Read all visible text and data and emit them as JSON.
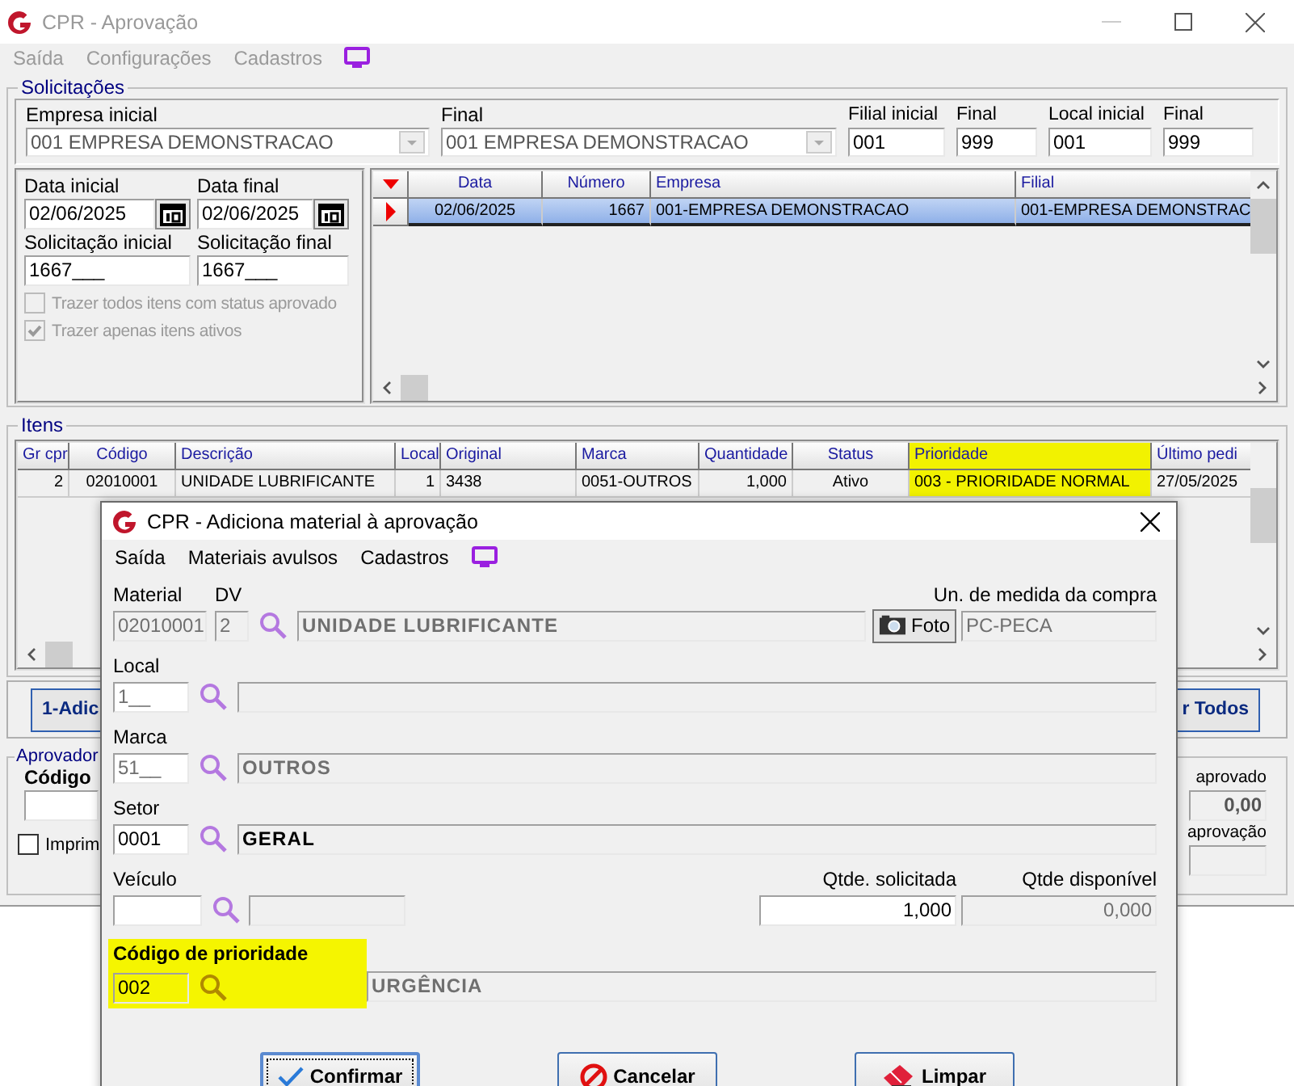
{
  "window": {
    "title": "CPR - Aprovação"
  },
  "menu": [
    {
      "label": "Saída",
      "disabled": true
    },
    {
      "label": "Configurações",
      "disabled": true
    },
    {
      "label": "Cadastros",
      "disabled": true
    }
  ],
  "solicitacoes": {
    "legend": "Solicitações",
    "filters": [
      {
        "label": "Empresa inicial",
        "value": "001 EMPRESA DEMONSTRACAO",
        "kind": "combo"
      },
      {
        "label": "Final",
        "value": "001 EMPRESA DEMONSTRACAO",
        "kind": "combo"
      },
      {
        "label": "Filial inicial",
        "value": "001",
        "kind": "text"
      },
      {
        "label": "Final",
        "value": "999",
        "kind": "text"
      },
      {
        "label": "Local inicial",
        "value": "001",
        "kind": "text"
      },
      {
        "label": "Final",
        "value": "999",
        "kind": "text"
      }
    ],
    "range": [
      {
        "label": "Data inicial",
        "value": "02/06/2025",
        "kind": "date"
      },
      {
        "label": "Data final",
        "value": "02/06/2025",
        "kind": "date"
      },
      {
        "label": "Solicitação inicial",
        "value": "1667___",
        "kind": "text"
      },
      {
        "label": "Solicitação final",
        "value": "1667___",
        "kind": "text"
      }
    ],
    "options": [
      {
        "label": "Trazer todos itens com status aprovado",
        "checked": false,
        "disabled": true
      },
      {
        "label": "Trazer apenas itens ativos",
        "checked": true,
        "disabled": true
      }
    ],
    "table": {
      "columns": [
        "Data",
        "Número",
        "Empresa",
        "Filial"
      ],
      "rows": [
        {
          "cells": [
            "02/06/2025",
            "1667",
            "001-EMPRESA DEMONSTRACAO",
            "001-EMPRESA DEMONSTRAC"
          ],
          "selected": true
        }
      ]
    }
  },
  "itens": {
    "legend": "Itens",
    "table": {
      "columns": [
        {
          "label": "Gr cpr",
          "highlighted": false
        },
        {
          "label": "Código",
          "highlighted": false
        },
        {
          "label": "Descrição",
          "highlighted": false
        },
        {
          "label": "Local",
          "highlighted": false
        },
        {
          "label": "Original",
          "highlighted": false
        },
        {
          "label": "Marca",
          "highlighted": false
        },
        {
          "label": "Quantidade",
          "highlighted": false
        },
        {
          "label": "Status",
          "highlighted": false
        },
        {
          "label": "Prioridade",
          "highlighted": true
        },
        {
          "label": "Último pedi",
          "highlighted": false
        }
      ],
      "rows": [
        {
          "cells": [
            "2",
            "02010001",
            "UNIDADE LUBRIFICANTE",
            "1",
            "3438",
            "0051-OUTROS",
            "1,000",
            "Ativo",
            "003 - PRIORIDADE NORMAL",
            "27/05/2025"
          ],
          "selected": false
        }
      ]
    }
  },
  "actions": [
    "1-Adic",
    "r Todos"
  ],
  "aprovador": {
    "legend": "Aprovador",
    "code_label": "Código",
    "print_option": {
      "label": "Imprim",
      "checked": false
    },
    "approved_label": "aprovado",
    "approved_value": "0,00",
    "approval_label": "aprovação"
  },
  "dialog": {
    "title": "CPR - Adiciona material à aprovação",
    "menu": [
      {
        "label": "Saída",
        "disabled": false
      },
      {
        "label": "Materiais avulsos",
        "disabled": false
      },
      {
        "label": "Cadastros",
        "disabled": false
      }
    ],
    "material": {
      "label": "Material",
      "value": "02010001"
    },
    "dv": {
      "label": "DV",
      "value": "2"
    },
    "material_description": "UNIDADE LUBRIFICANTE",
    "photo_button": "Foto",
    "unit": {
      "label": "Un. de medida da compra",
      "value": "PC-PECA"
    },
    "lookups": [
      {
        "label": "Local",
        "code": "1__",
        "disabled": true
      },
      {
        "label": "Marca",
        "code": "51__",
        "description": "OUTROS",
        "disabled": true
      },
      {
        "label": "Setor",
        "code": "0001",
        "description": "GERAL",
        "disabled": false
      }
    ],
    "vehicle": {
      "label": "Veículo"
    },
    "quantity_requested": {
      "label": "Qtde. solicitada",
      "value": "1,000"
    },
    "quantity_available": {
      "label": "Qtde disponível",
      "value": "0,000"
    },
    "priority": {
      "label": "Código de prioridade",
      "code": "002",
      "description": "URGÊNCIA",
      "highlighted": true
    },
    "buttons": [
      {
        "label": "Confirmar",
        "kind": "confirm"
      },
      {
        "label": "Cancelar",
        "kind": "cancel"
      },
      {
        "label": "Limpar",
        "kind": "clear"
      }
    ]
  }
}
